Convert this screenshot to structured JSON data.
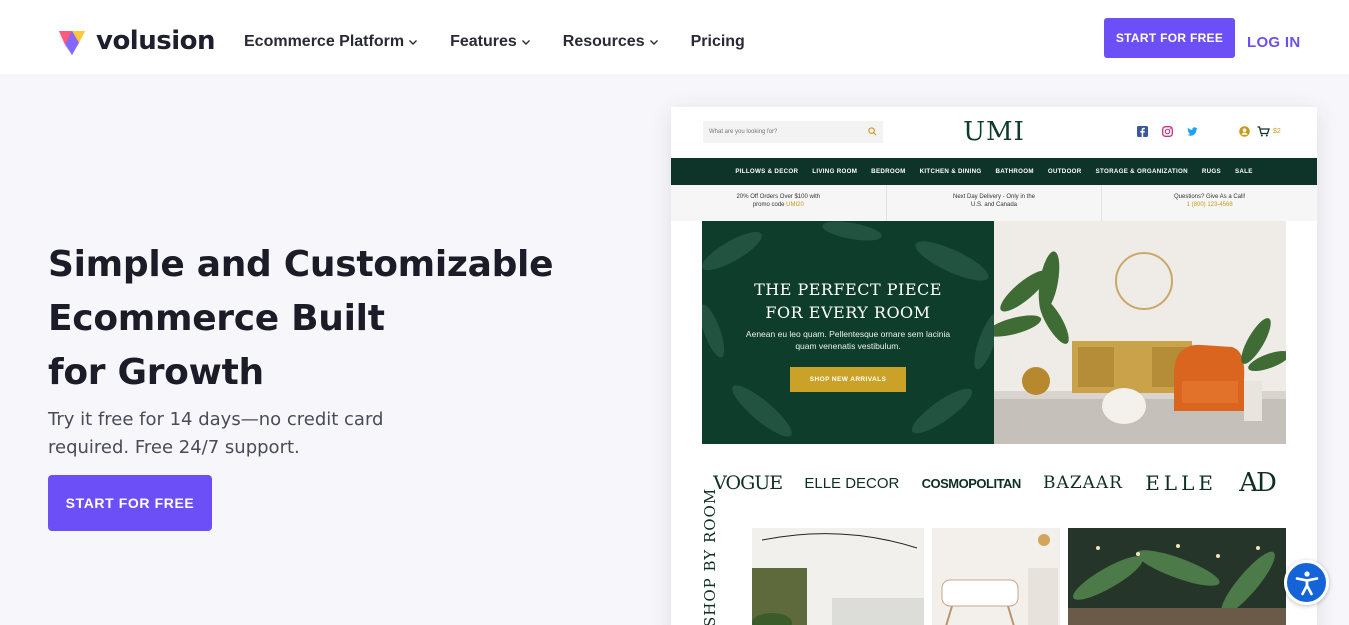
{
  "brand": {
    "name": "volusion",
    "accent": "#6c4ff6"
  },
  "nav": {
    "items": [
      {
        "label": "Ecommerce Platform",
        "has_dropdown": true
      },
      {
        "label": "Features",
        "has_dropdown": true
      },
      {
        "label": "Resources",
        "has_dropdown": true
      },
      {
        "label": "Pricing",
        "has_dropdown": false
      }
    ],
    "cta_label": "START FOR FREE",
    "login_label": "LOG IN"
  },
  "hero": {
    "title_lines": [
      "Simple and Customizable",
      "Ecommerce Built",
      "for Growth"
    ],
    "subtitle_lines": [
      "Try it free for 14 days—no credit card",
      "required. Free 24/7 support."
    ],
    "cta_label": "START FOR FREE"
  },
  "mockup": {
    "search_placeholder": "What are you looking for?",
    "logo": "UMI",
    "cart_count": "$2",
    "nav": [
      "PILLOWS & DECOR",
      "LIVING ROOM",
      "BEDROOM",
      "KITCHEN & DINING",
      "BATHROOM",
      "OUTDOOR",
      "STORAGE & ORGANIZATION",
      "RUGS",
      "SALE"
    ],
    "promos": [
      {
        "line1": "20% Off Orders Over $100 with",
        "line2": "promo code ",
        "highlight": "UMI20"
      },
      {
        "line1": "Next Day Delivery - Only in the",
        "line2": "U.S. and Canada",
        "highlight": ""
      },
      {
        "line1": "Questions? Give As a Call!",
        "line2": "",
        "highlight": "1 (800) 123-4568"
      }
    ],
    "banner": {
      "title_lines": [
        "THE PERFECT PIECE",
        "FOR EVERY ROOM"
      ],
      "subtitle": "Aenean eu leo quam. Pellentesque ornare sem lacinia quam venenatis vestibulum.",
      "button": "SHOP NEW ARRIVALS"
    },
    "press": [
      "VOGUE",
      "ELLE DECOR",
      "COSMOPOLITAN",
      "BAZAAR",
      "ELLE",
      "AD"
    ],
    "shop_by_room": "SHOP BY ROOM"
  },
  "icons": {
    "facebook": "facebook-icon",
    "instagram": "instagram-icon",
    "twitter": "twitter-icon",
    "account": "account-icon",
    "cart": "cart-icon",
    "accessibility": "accessibility-icon"
  }
}
